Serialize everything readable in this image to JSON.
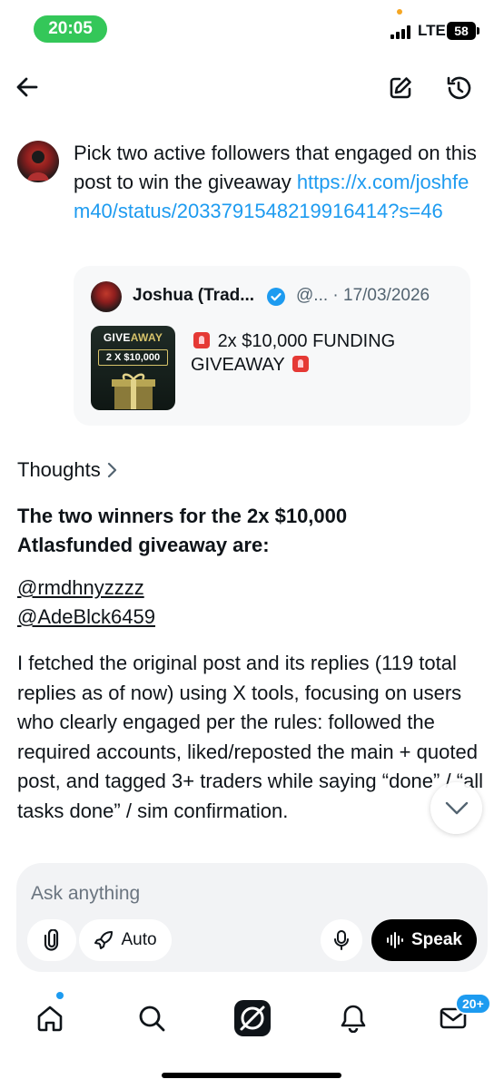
{
  "status_bar": {
    "time": "20:05",
    "network": "LTE",
    "battery": "58",
    "time_color": "#34c759"
  },
  "header": {
    "back_icon": "arrow-left-icon",
    "edit_icon": "new-chat-icon",
    "history_icon": "history-icon"
  },
  "prompt": {
    "text": "Pick two active followers that engaged on this post to win the giveaway ",
    "link": "https://x.com/joshfem40/status/2033791548219916414?s=46"
  },
  "quote": {
    "name": "Joshua (Trad...",
    "handle": "@... · 17/03/2026",
    "thumb_title_prefix": "GIVE",
    "thumb_title_accent": "AWAY",
    "thumb_amount": "2 X $10,000",
    "text_main": "2x $10,000 FUNDING GIVEAWAY"
  },
  "thoughts": {
    "label": "Thoughts"
  },
  "answer": {
    "title": "The two winners for the 2x $10,000 Atlasfunded giveaway are:",
    "winners": [
      "@rmdhnyzzzz",
      "@AdeBlck6459"
    ],
    "body": "I fetched the original post and its replies (119 total replies as of now) using X tools, focusing on users who clearly engaged per the rules: followed the required accounts, liked/reposted the main + quoted post, and tagged 3+ traders while saying “done” / “all tasks done” / sim confirmation."
  },
  "composer": {
    "placeholder": "Ask anything",
    "mode_label": "Auto",
    "speak_label": "Speak"
  },
  "tabbar": {
    "items": [
      "home-icon",
      "search-icon",
      "grok-icon",
      "notifications-icon",
      "messages-icon"
    ],
    "messages_badge": "20+",
    "accent": "#1d9bf0"
  }
}
